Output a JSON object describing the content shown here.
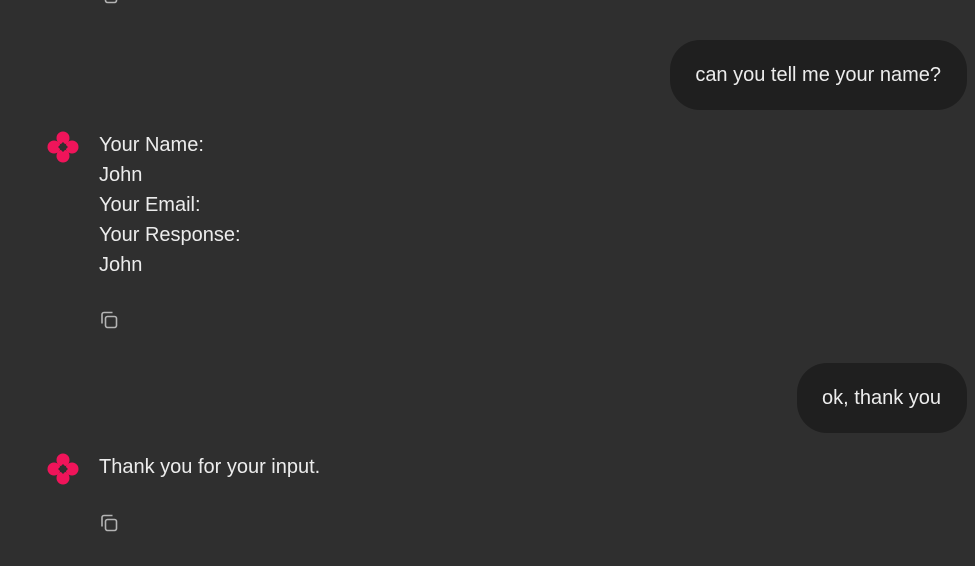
{
  "messages": {
    "user_1": {
      "text": "can you tell me your name?"
    },
    "assistant_1": {
      "lines": [
        "Your Name:",
        "John",
        "Your Email:",
        "Your Response:",
        "John"
      ]
    },
    "user_2": {
      "text": "ok, thank you"
    },
    "assistant_2": {
      "text": "Thank you for your input."
    }
  },
  "icons": {
    "avatar": "assistant-logo-icon",
    "copy": "copy-icon"
  },
  "colors": {
    "background": "#2f2f2f",
    "user_bubble": "#1f1f1f",
    "text": "#ececec",
    "brand_accent": "#f0145a",
    "icon_gray": "#b4b4b4"
  }
}
